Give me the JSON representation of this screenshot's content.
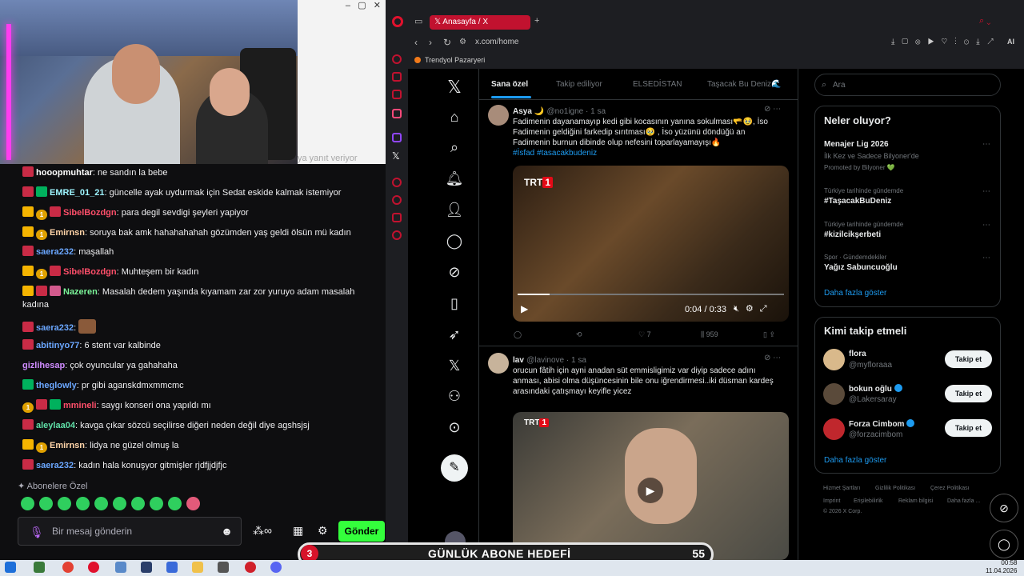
{
  "stream": {
    "side_text": "ya yanıt veriyor",
    "chat": [
      {
        "user": "hooopmuhtar",
        "color": "#ffffff",
        "badges": [
          "red"
        ],
        "text": "ne sandın la bebe"
      },
      {
        "user": "EMRE_01_21",
        "color": "#9ef5ff",
        "badges": [
          "red",
          "green"
        ],
        "text": "güncelle ayak uydurmak için Sedat eskide kalmak istemiyor"
      },
      {
        "user": "SibelBozdgn",
        "color": "#ff4f6a",
        "badges": [
          "crown",
          "one",
          "red"
        ],
        "text": "para degil sevdigi şeyleri yapiyor"
      },
      {
        "user": "Emirnsn",
        "color": "#ffd4a8",
        "badges": [
          "crown",
          "one"
        ],
        "text": "soruya bak amk hahahahahah gözümden yaş geldi ölsün mü kadın"
      },
      {
        "user": "saera232",
        "color": "#6ba7ff",
        "badges": [
          "red"
        ],
        "text": "maşallah"
      },
      {
        "user": "SibelBozdgn",
        "color": "#ff4f6a",
        "badges": [
          "crown",
          "one",
          "red"
        ],
        "text": "Muhteşem bir kadın"
      },
      {
        "user": "Nazeren",
        "color": "#7cf59a",
        "badges": [
          "crown",
          "red",
          "pink"
        ],
        "text": "Masalah dedem yaşında kıyamam zar zor yuruyo adam masalah kadına"
      },
      {
        "user": "saera232",
        "color": "#6ba7ff",
        "badges": [
          "red"
        ],
        "text": ""
      },
      {
        "user": "abitinyo77",
        "color": "#6ba7ff",
        "badges": [
          "red"
        ],
        "text": "6 stent var kalbinde"
      },
      {
        "user": "gizlihesap",
        "color": "#cf8cff",
        "badges": [],
        "text": "çok oyuncular ya gahahaha"
      },
      {
        "user": "theglowly",
        "color": "#6ba7ff",
        "badges": [
          "green"
        ],
        "text": "pr gibi aganskdmxmmcmc"
      },
      {
        "user": "mmineli",
        "color": "#ff4f6a",
        "badges": [
          "one",
          "red",
          "green"
        ],
        "text": "saygı konseri ona yapıldı mı"
      },
      {
        "user": "aleylaa04",
        "color": "#5fe0a8",
        "badges": [
          "red"
        ],
        "text": "kavga çıkar sözcü seçilirse diğeri neden değil diye agshsjsj"
      },
      {
        "user": "Emirnsn",
        "color": "#ffd4a8",
        "badges": [
          "crown",
          "one"
        ],
        "text": "lidya ne güzel olmuş la"
      },
      {
        "user": "saera232",
        "color": "#6ba7ff",
        "badges": [
          "red"
        ],
        "text": "kadın hala konuşyor gitmişler rjdfjjdjfjc"
      }
    ],
    "subscribers_only": "Abonelere Özel",
    "input_placeholder": "Bir mesaj gönderin",
    "send_label": "Gönder",
    "goal_number": "3",
    "goal_title": "GÜNLÜK ABONE HEDEFİ",
    "goal_value": "55"
  },
  "browser": {
    "tab_title": "Anasayfa / X",
    "url": "x.com/home",
    "bookmark": "Trendyol Pazaryeri"
  },
  "x": {
    "feed_tabs": [
      "Sana özel",
      "Takip ediliyor",
      "ELSEDİSTAN",
      "Taşacak Bu Deniz🌊"
    ],
    "tweets": [
      {
        "name": "Asya 🌙",
        "handle": "@no1igne · 1 sa",
        "text": "Fadimenin dayanamayıp kedi gibi kocasının yanına sokulması🫳🥹, İso Fadimenin geldiğini farkedip sırıtması🥹 , İso yüzünü döndüğü an Fadimenin burnun dibinde olup nefesini toparlayamayışı🔥",
        "tags": "#İsfad #tasacakbudeniz",
        "channel": "TRT",
        "time": "0:04 / 0:33",
        "likes": "7",
        "views": "959"
      },
      {
        "name": "lav",
        "handle": "@lavinove · 1 sa",
        "text": "orucun fâtih için ayni anadan süt emmisligimiz var diyip sadece adını anması, abisi olma düşüncesinin bile onu iğrendirmesi..iki düsman kardeş arasındaki çatışmayı keyifle yicez",
        "channel": "TRT"
      }
    ],
    "search_placeholder": "Ara",
    "trends_title": "Neler oluyor?",
    "trends": [
      {
        "meta": "",
        "title": "Menajer Lig 2026",
        "sub": "İlk Kez ve Sadece Bilyoner'de",
        "promo": "Promoted by Bilyoner 💚"
      },
      {
        "meta": "Türkiye tarihinde gündemde",
        "title": "#TaşacakBuDeniz"
      },
      {
        "meta": "Türkiye tarihinde gündemde",
        "title": "#kizilcikşerbeti"
      },
      {
        "meta": "Spor · Gündemdekiler",
        "title": "Yağız Sabuncuoğlu"
      }
    ],
    "show_more": "Daha fazla göster",
    "follow_title": "Kimi takip etmeli",
    "follow": [
      {
        "name": "flora",
        "handle": "@myfloraaa",
        "verified": false
      },
      {
        "name": "bokun oğlu",
        "handle": "@Lakersaray",
        "verified": true
      },
      {
        "name": "Forza Cimbom",
        "handle": "@forzacimbom",
        "verified": true
      }
    ],
    "follow_label": "Takip et",
    "footer": [
      "Hizmet Şartları",
      "Gizlilik Politikası",
      "Çerez Politikası",
      "Imprint",
      "Erişilebilirlik",
      "Reklam bilgisi",
      "Daha fazla ...",
      "© 2026 X Corp."
    ]
  },
  "taskbar": {
    "time": "00:58",
    "date": "11.04.2026"
  }
}
